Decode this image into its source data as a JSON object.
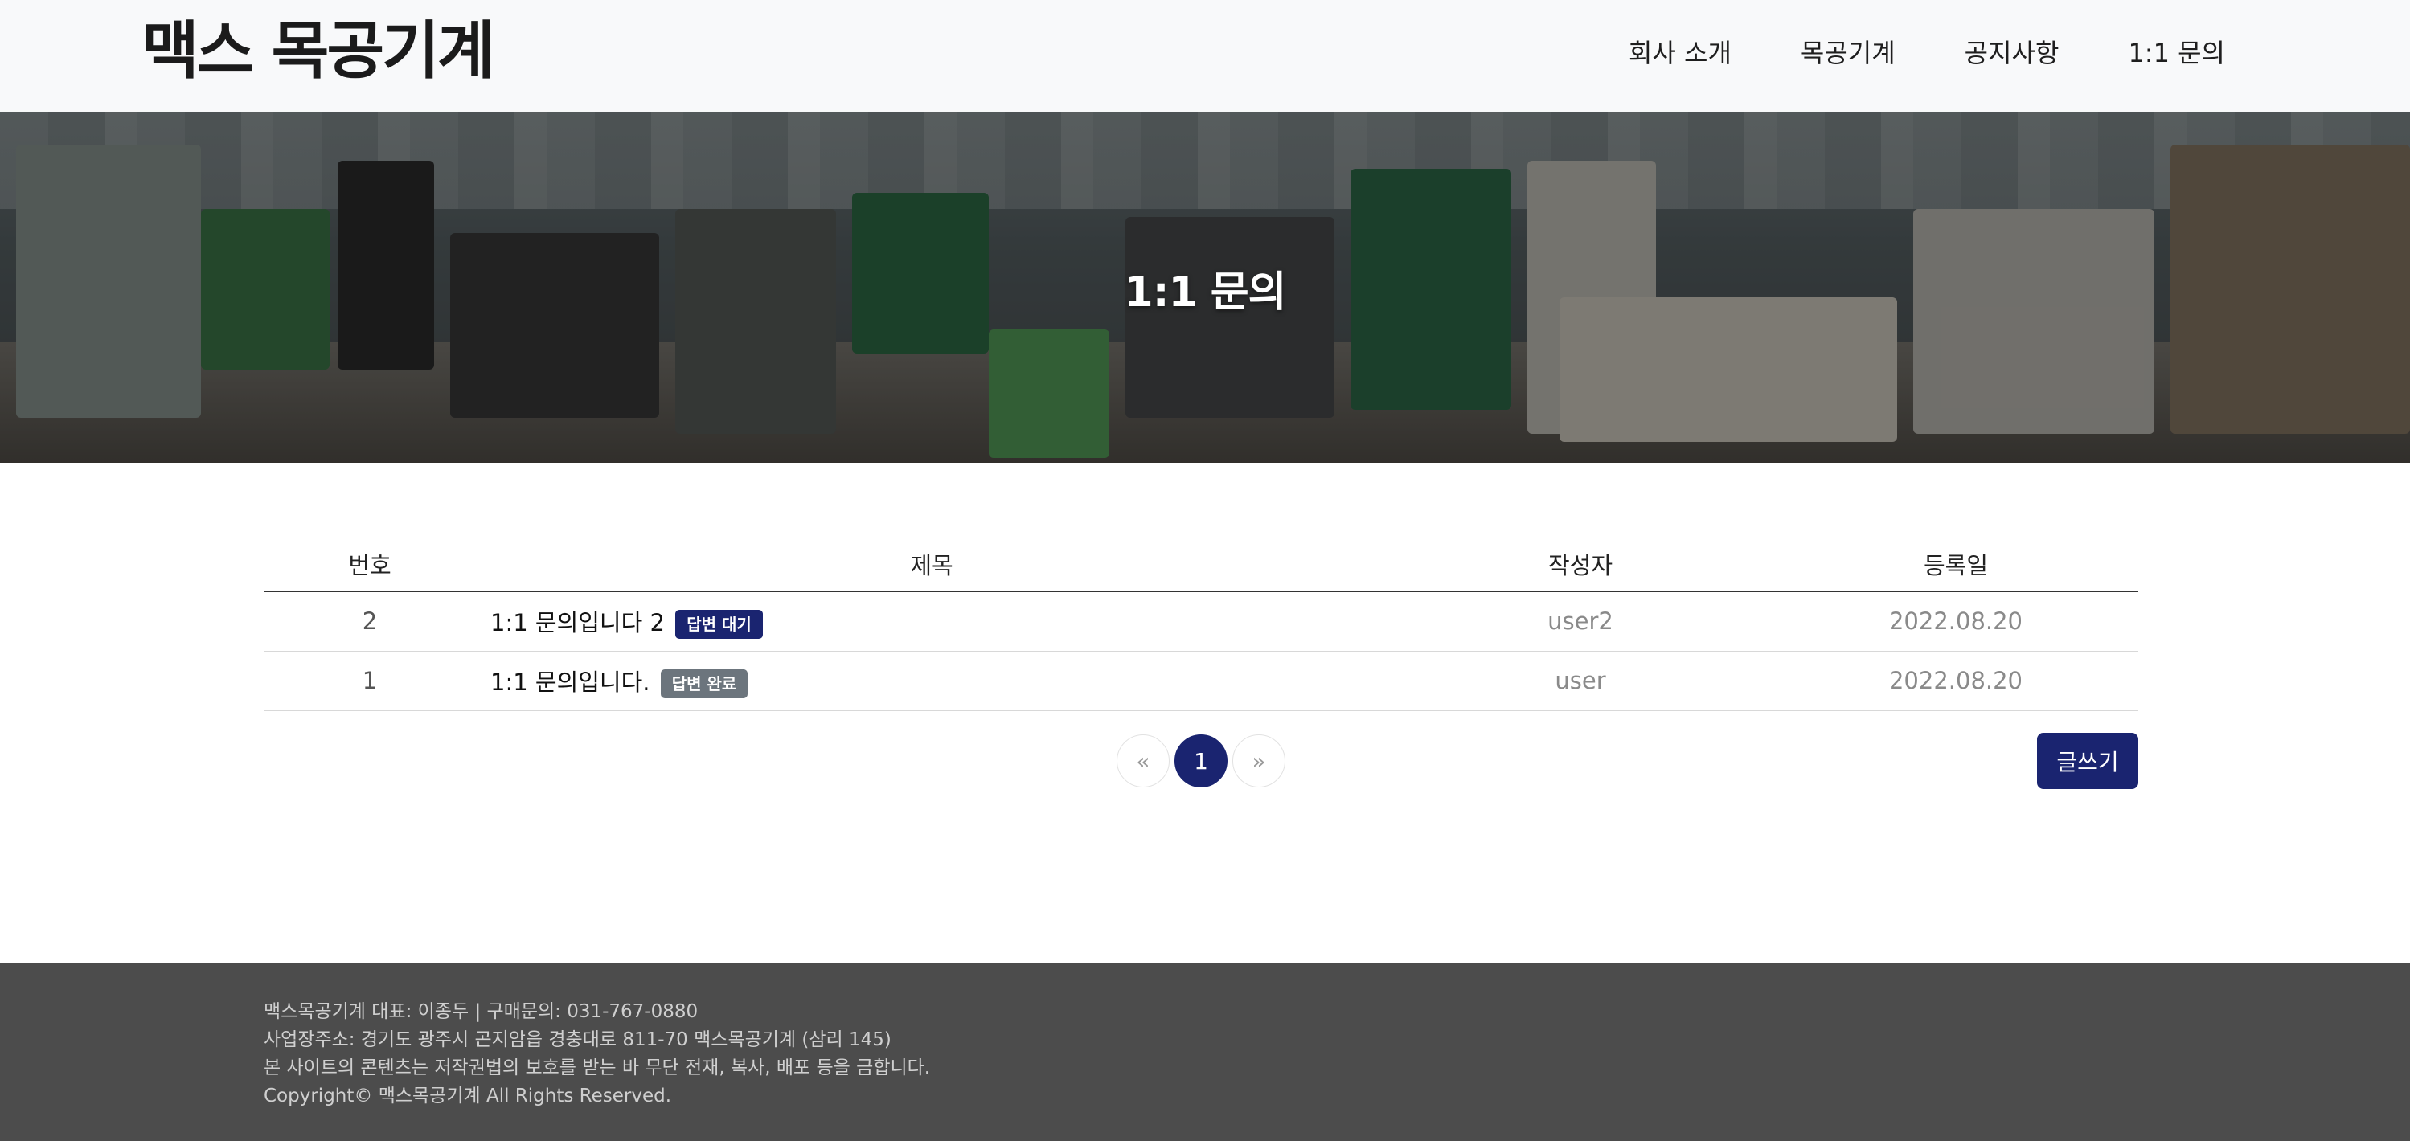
{
  "header": {
    "brand": "맥스 목공기계",
    "nav": [
      {
        "label": "회사 소개"
      },
      {
        "label": "목공기계"
      },
      {
        "label": "공지사항"
      },
      {
        "label": "1:1 문의"
      }
    ]
  },
  "hero": {
    "title": "1:1 문의"
  },
  "board": {
    "columns": [
      "번호",
      "제목",
      "작성자",
      "등록일"
    ],
    "rows": [
      {
        "no": "2",
        "subject": "1:1 문의입니다 2",
        "status": "답변 대기",
        "author": "user2",
        "date": "2022.08.20"
      },
      {
        "no": "1",
        "subject": "1:1 문의입니다.",
        "status": "답변 완료",
        "author": "user",
        "date": "2022.08.20"
      }
    ]
  },
  "pagination": {
    "prev": "«",
    "current": "1",
    "next": "»"
  },
  "actions": {
    "write_label": "글쓰기"
  },
  "footer": {
    "lines": [
      "맥스목공기계 대표: 이종두 | 구매문의: 031-767-0880",
      "사업장주소: 경기도 광주시 곤지암읍 경충대로 811-70 맥스목공기계 (삼리 145)",
      "본 사이트의 콘텐츠는 저작권법의 보호를 받는 바 무단 전재, 복사, 배포 등을 금합니다.",
      "Copyright© 맥스목공기계 All Rights Reserved."
    ]
  },
  "colors": {
    "primary": "#1a2470",
    "muted_badge": "#6c757d",
    "footer_bg": "#4c4c4c",
    "header_bg": "#f8f9fa"
  }
}
